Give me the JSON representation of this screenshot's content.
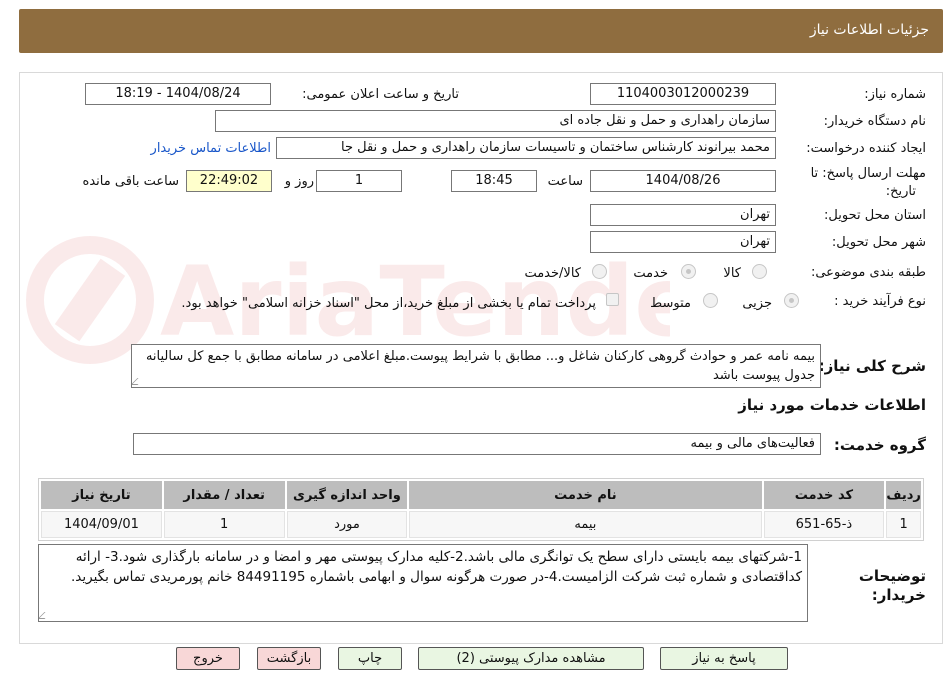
{
  "header": {
    "title": "جزئیات اطلاعات نیاز"
  },
  "fields": {
    "need_number_label": "شماره نیاز:",
    "need_number": "1104003012000239",
    "announce_label": "تاریخ و ساعت اعلان عمومی:",
    "announce_value": "1404/08/24 - 18:19",
    "buyer_org_label": "نام دستگاه خریدار:",
    "buyer_org": "سازمان راهداری و حمل و نقل جاده ای",
    "requester_label": "ایجاد کننده درخواست:",
    "requester": "محمد بیرانوند کارشناس ساختمان و تاسیسات سازمان راهداری و حمل و نقل جا",
    "contact_link": "اطلاعات تماس خریدار",
    "deadline_label_1": "مهلت ارسال پاسخ: تا",
    "deadline_label_2": "تاریخ:",
    "deadline_date": "1404/08/26",
    "time_label": "ساعت",
    "deadline_time": "18:45",
    "days_value": "1",
    "days_label": "روز و",
    "remaining_time": "22:49:02",
    "remaining_label": "ساعت باقی مانده",
    "province_label": "استان محل تحویل:",
    "province": "تهران",
    "city_label": "شهر محل تحویل:",
    "city": "تهران",
    "category_label": "طبقه بندی موضوعی:",
    "category_options": [
      "کالا",
      "خدمت",
      "کالا/خدمت"
    ],
    "category_selected": "خدمت",
    "process_label": "نوع فرآیند خرید :",
    "process_options": [
      "جزیی",
      "متوسط"
    ],
    "process_selected": "جزیی",
    "payment_note": "پرداخت تمام یا بخشی از مبلغ خرید،از محل \"اسناد خزانه اسلامی\" خواهد بود.",
    "description_label": "شرح کلی نیاز:",
    "description": "بیمه نامه عمر و حوادث گروهی کارکنان شاغل و... مطابق با شرایط پیوست.مبلغ اعلامی در سامانه مطابق با جمع کل سالیانه جدول پیوست باشد",
    "services_title": "اطلاعات خدمات مورد نیاز",
    "service_group_label": "گروه خدمت:",
    "service_group": "فعالیت‌های مالی و بیمه",
    "buyer_notes_label_1": "توضیحات",
    "buyer_notes_label_2": "خریدار:",
    "buyer_notes": "1-شرکتهای بیمه بایستی دارای سطح یک توانگری مالی باشد.2-کلیه مدارک پیوستی مهر و امضا و در سامانه بارگذاری شود.3- ارائه کداقتصادی و شماره ثبت شرکت الزامیست.4-در صورت هرگونه سوال و ابهامی باشماره 84491195 خانم پورمریدی تماس بگیرید."
  },
  "table": {
    "headers": [
      "ردیف",
      "کد خدمت",
      "نام خدمت",
      "واحد اندازه گیری",
      "تعداد / مقدار",
      "تاریخ نیاز"
    ],
    "rows": [
      [
        "1",
        "ذ-65-651",
        "بیمه",
        "مورد",
        "1",
        "1404/09/01"
      ]
    ]
  },
  "buttons": {
    "reply": "پاسخ به نیاز",
    "attachments": "مشاهده مدارک پیوستی (2)",
    "print": "چاپ",
    "back": "بازگشت",
    "exit": "خروج"
  },
  "watermark_text": "AriaTender.neT",
  "colors": {
    "header": "#8f6d3f",
    "link": "#1a57c9",
    "remaining_bg": "#ffffcc",
    "button_green": "#e9f6e2",
    "button_pink": "#f8d7d7"
  }
}
